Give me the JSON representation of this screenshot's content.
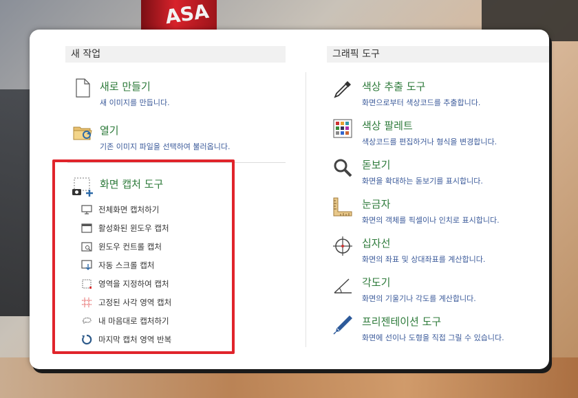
{
  "background": {
    "can_text": "ASA"
  },
  "left": {
    "header": "새 작업",
    "new": {
      "title": "새로 만들기",
      "desc": "새 이미지를 만듭니다."
    },
    "open": {
      "title": "열기",
      "desc": "기존 이미지 파일을 선택하여 불러옵니다."
    },
    "capture": {
      "title": "화면 캡처 도구",
      "items": [
        {
          "label": "전체화면 캡처하기",
          "icon": "monitor-icon"
        },
        {
          "label": "활성화된 윈도우 캡처",
          "icon": "window-icon"
        },
        {
          "label": "윈도우 컨트롤 캡처",
          "icon": "window-search-icon"
        },
        {
          "label": "자동 스크롤 캡처",
          "icon": "scroll-down-icon"
        },
        {
          "label": "영역을 지정하여 캡처",
          "icon": "dashed-rect-icon"
        },
        {
          "label": "고정된 사각 영역 캡처",
          "icon": "grid-rect-icon"
        },
        {
          "label": "내 마음대로 캡처하기",
          "icon": "lasso-icon"
        },
        {
          "label": "마지막 캡처 영역 반복",
          "icon": "repeat-icon"
        }
      ]
    }
  },
  "right": {
    "header": "그래픽 도구",
    "items": [
      {
        "title": "색상 추출 도구",
        "desc": "화면으로부터 색상코드를 추출합니다.",
        "icon": "eyedropper-icon"
      },
      {
        "title": "색상 팔레트",
        "desc": "색상코드를 편집하거나 형식을 변경합니다.",
        "icon": "palette-icon"
      },
      {
        "title": "돋보기",
        "desc": "화면을 확대하는 돋보기를 표시합니다.",
        "icon": "magnifier-icon"
      },
      {
        "title": "눈금자",
        "desc": "화면의 객체를 픽셀이나 인치로 표시합니다.",
        "icon": "ruler-icon"
      },
      {
        "title": "십자선",
        "desc": "화면의 좌표 및 상대좌표를 계산합니다.",
        "icon": "crosshair-icon"
      },
      {
        "title": "각도기",
        "desc": "화면의 기울기나 각도를 계산합니다.",
        "icon": "protractor-icon"
      },
      {
        "title": "프리젠테이션 도구",
        "desc": "화면에 선이나 도형을 직접 그릴 수 있습니다.",
        "icon": "pen-icon"
      }
    ]
  },
  "colors": {
    "title_green": "#2d7a3a",
    "desc_blue": "#3b5a9a",
    "highlight_red": "#e0242b"
  }
}
